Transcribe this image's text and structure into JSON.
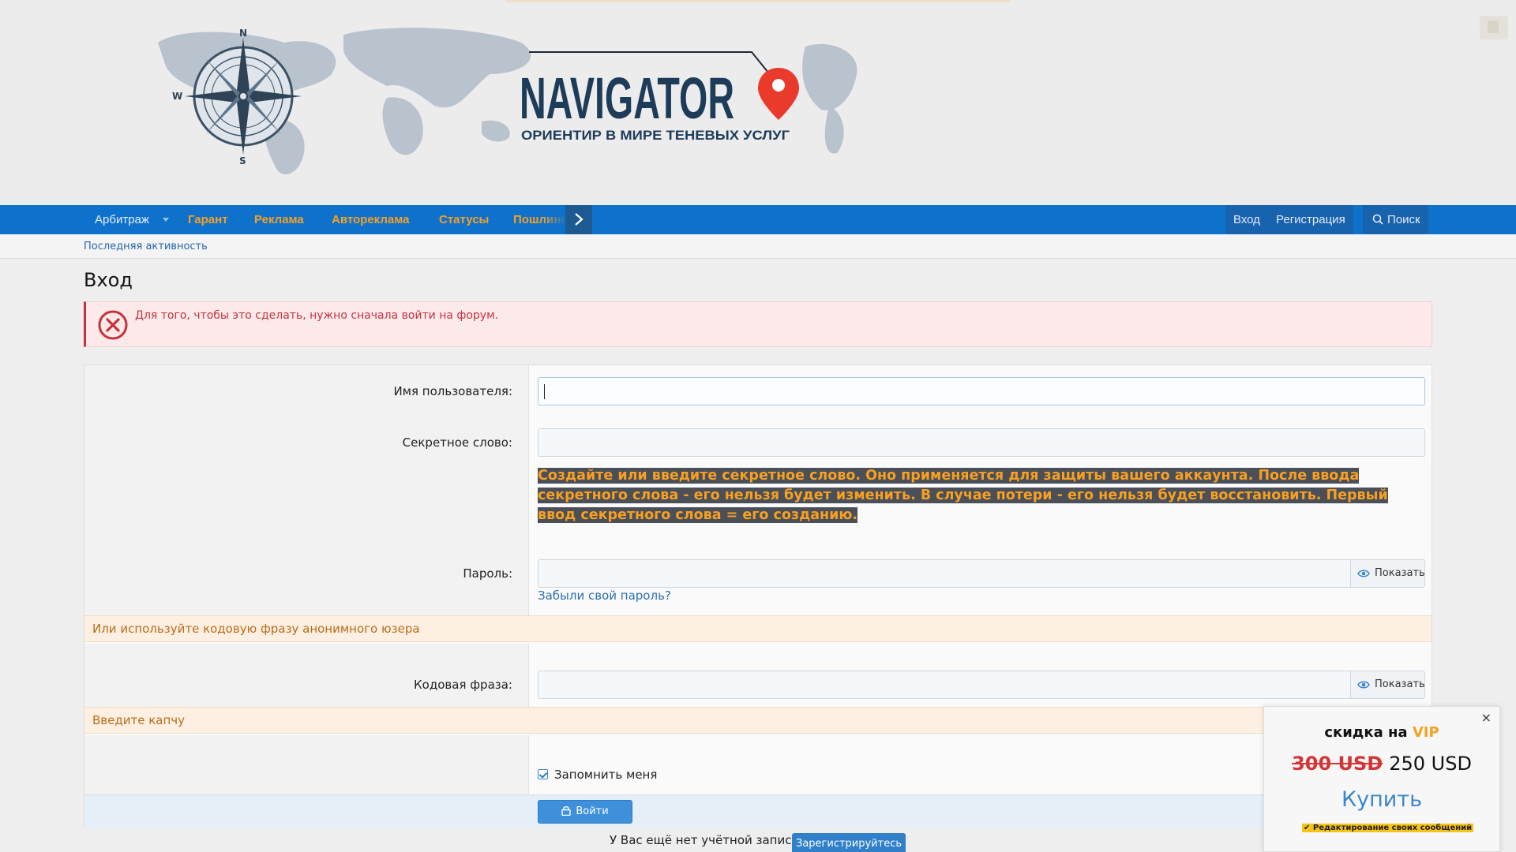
{
  "banner": {
    "brand": "NAVIGATOR",
    "tagline": "ОРИЕНТИР В МИРЕ ТЕНЕВЫХ УСЛУГ",
    "compass": {
      "n": "N",
      "s": "S",
      "w": "W"
    }
  },
  "nav": {
    "items": [
      "Арбитраж",
      "Гарант",
      "Реклама",
      "Автореклама",
      "Статусы",
      "Пошлины"
    ],
    "login": "Вход",
    "register": "Регистрация",
    "search": "Поиск"
  },
  "subnav": {
    "latest": "Последняя активность"
  },
  "page": {
    "title": "Вход",
    "error": "Для того, чтобы это сделать, нужно сначала войти на форум."
  },
  "form": {
    "username_label": "Имя пользователя:",
    "secret_label": "Секретное слово:",
    "secret_note": "Создайте или введите секретное слово. Оно применяется для защиты вашего аккаунта. После ввода секретного слова - его нельзя будет изменить. В случае потери - его нельзя будет восстановить. Первый ввод секретного слова = его созданию.",
    "password_label": "Пароль:",
    "show": "Показать",
    "forgot": "Забыли свой пароль?",
    "anon_band": "Или используйте кодовую фразу анонимного юзера",
    "code_label": "Кодовая фраза:",
    "captcha_band": "Введите капчу",
    "remember": "Запомнить меня",
    "login_button": "Войти"
  },
  "signup": {
    "question": "У Вас ещё нет учётной записи?",
    "button": "Зарегистрируйтесь"
  },
  "vip_popup": {
    "close": "×",
    "title_prefix": "скидка на",
    "title_accent": "VIP",
    "old_price": "300 USD",
    "new_price": "250 USD",
    "buy": "Купить",
    "note": "✔ Редактирование своих сообщений"
  },
  "colors": {
    "nav_bg": "#0e72cc",
    "nav_accent": "#f7a022",
    "error_text": "#c43540",
    "link": "#2a6fb0",
    "band_text": "#b86c1a"
  }
}
